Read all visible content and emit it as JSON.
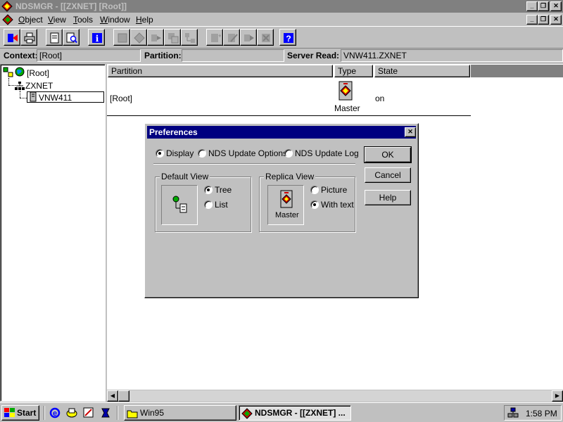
{
  "window": {
    "title": "NDSMGR - [[ZXNET] [Root]]"
  },
  "menu": [
    {
      "label": "Object",
      "mnemonic": "O",
      "rest": "bject"
    },
    {
      "label": "View",
      "mnemonic": "V",
      "rest": "iew"
    },
    {
      "label": "Tools",
      "mnemonic": "T",
      "rest": "ools"
    },
    {
      "label": "Window",
      "mnemonic": "W",
      "rest": "indow"
    },
    {
      "label": "Help",
      "mnemonic": "H",
      "rest": "elp"
    }
  ],
  "context": {
    "context_label": "Context:",
    "context_value": "[Root]",
    "partition_label": "Partition:",
    "partition_value": "",
    "server_label": "Server Read:",
    "server_value": "VNW411.ZXNET"
  },
  "tree": {
    "root": "[Root]",
    "org": "ZXNET",
    "server": "VNW411"
  },
  "table": {
    "headers": {
      "partition": "Partition",
      "type": "Type",
      "state": "State"
    },
    "rows": [
      {
        "partition": "[Root]",
        "type": "Master",
        "state": "on"
      }
    ]
  },
  "dialog": {
    "title": "Preferences",
    "tabs": [
      {
        "label": "Display",
        "selected": true
      },
      {
        "label": "NDS Update Options",
        "selected": false
      },
      {
        "label": "NDS Update Log",
        "selected": false
      }
    ],
    "default_view": {
      "title": "Default View",
      "options": [
        {
          "label": "Tree",
          "selected": true
        },
        {
          "label": "List",
          "selected": false
        }
      ]
    },
    "replica_view": {
      "title": "Replica View",
      "preview_label": "Master",
      "options": [
        {
          "label": "Picture",
          "selected": false
        },
        {
          "label": "With text",
          "selected": true
        }
      ]
    },
    "buttons": {
      "ok": "OK",
      "cancel": "Cancel",
      "help": "Help"
    }
  },
  "taskbar": {
    "start": "Start",
    "tasks": [
      {
        "label": "Win95"
      },
      {
        "label": "NDSMGR - [[ZXNET] ..."
      }
    ],
    "clock": "1:58 PM"
  }
}
